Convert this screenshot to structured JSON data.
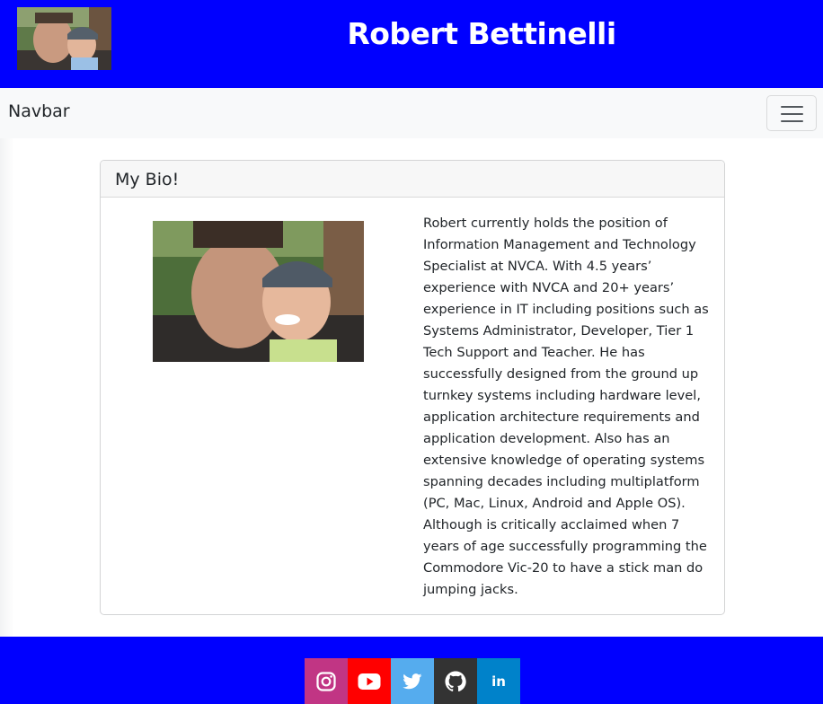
{
  "header": {
    "title": "Robert Bettinelli",
    "avatar_alt": "Robert and son"
  },
  "navbar": {
    "brand": "Navbar",
    "toggler_icon": "hamburger-icon"
  },
  "bio_card": {
    "title": "My Bio!",
    "photo_alt": "Robert and son",
    "text": "Robert currently holds the position of Information Management and Technology Specialist at NVCA. With 4.5 years’ experience with NVCA and 20+ years’ experience in IT including positions such as Systems Administrator, Developer, Tier 1 Tech Support and Teacher. He has successfully designed from the ground up turnkey systems including hardware level, application architecture requirements and application development. Also has an extensive knowledge of operating systems spanning decades including multiplatform (PC, Mac, Linux, Android and Apple OS). Although is critically acclaimed when 7 years of age successfully programming the Commodore Vic-20 to have a stick man do jumping jacks."
  },
  "footer": {
    "social": [
      {
        "name": "instagram",
        "icon": "instagram-icon",
        "color": "#c13584"
      },
      {
        "name": "youtube",
        "icon": "youtube-icon",
        "color": "#ff0000"
      },
      {
        "name": "twitter",
        "icon": "twitter-icon",
        "color": "#55acee"
      },
      {
        "name": "github",
        "icon": "github-icon",
        "color": "#333333"
      },
      {
        "name": "linkedin",
        "icon": "linkedin-icon",
        "color": "#0082ca",
        "label": "in"
      }
    ]
  },
  "colors": {
    "header_bg": "#0000ff",
    "footer_bg": "#0000ff",
    "navbar_bg": "#f8f9fa"
  }
}
